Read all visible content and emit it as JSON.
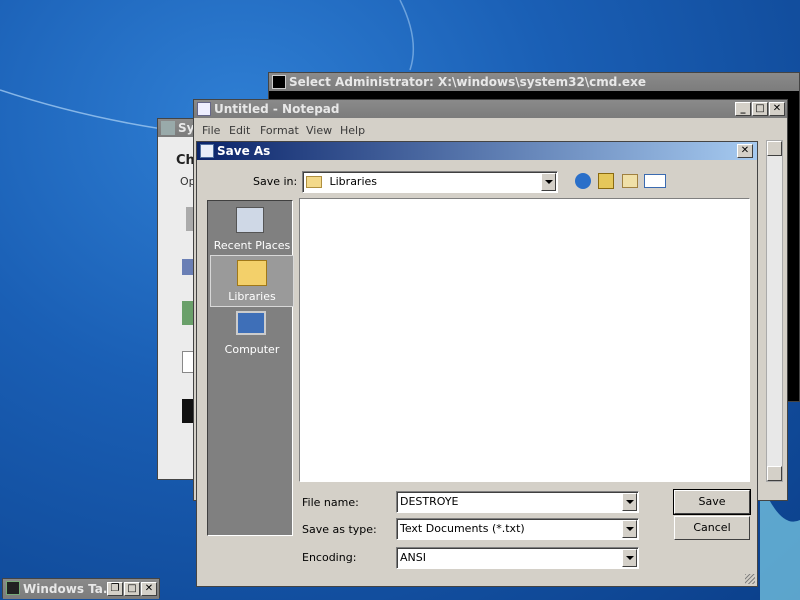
{
  "cmd_window": {
    "title": "Select Administrator: X:\\windows\\system32\\cmd.exe"
  },
  "notepad": {
    "title": "Untitled - Notepad",
    "menu": [
      "File",
      "Edit",
      "Format",
      "View",
      "Help"
    ]
  },
  "sysprops": {
    "title": "Sy",
    "heading": "Ch",
    "subtext": "Op"
  },
  "save_dialog": {
    "title": "Save As",
    "save_in_label": "Save in:",
    "save_in_value": "Libraries",
    "places": [
      {
        "label": "Recent Places",
        "icon": "recent-places-icon"
      },
      {
        "label": "Libraries",
        "icon": "libraries-icon"
      },
      {
        "label": "Computer",
        "icon": "computer-icon"
      }
    ],
    "file_name_label": "File name:",
    "file_name_value": "DESTROYE",
    "save_as_type_label": "Save as type:",
    "save_as_type_value": "Text Documents (*.txt)",
    "encoding_label": "Encoding:",
    "encoding_value": "ANSI",
    "save_button": "Save",
    "cancel_button": "Cancel",
    "close_glyph": "✕"
  },
  "taskbar_window": {
    "title": "Windows Ta..."
  },
  "caption_glyphs": {
    "minimize": "_",
    "maximize": "□",
    "close": "✕",
    "restore": "❐"
  },
  "colors": {
    "desktop": "#1a5fb5",
    "dialog_face": "#d4d0c8",
    "places_bar": "#808080",
    "active_title": "#0a246a"
  }
}
